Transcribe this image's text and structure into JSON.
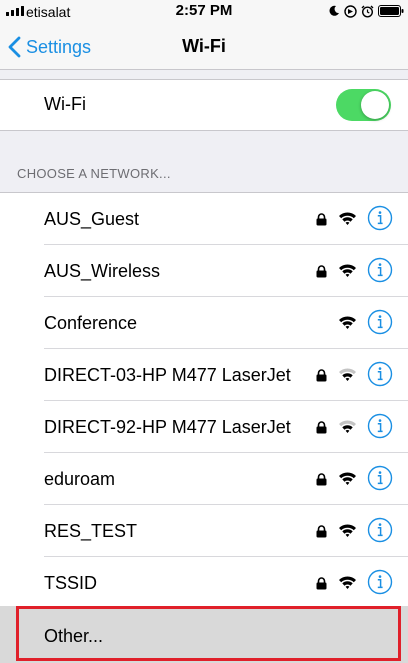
{
  "status_bar": {
    "carrier": "etisalat",
    "time": "2:57 PM",
    "icons": [
      "signal-bars-icon",
      "moon-icon",
      "location-lock-icon",
      "alarm-icon",
      "battery-icon"
    ]
  },
  "nav": {
    "back_label": "Settings",
    "title": "Wi-Fi"
  },
  "wifi_toggle": {
    "label": "Wi-Fi",
    "state": "on",
    "on_color": "#4cd964"
  },
  "section_header": "CHOOSE A NETWORK...",
  "networks": [
    {
      "name": "AUS_Guest",
      "secured": true,
      "signal": "full"
    },
    {
      "name": "AUS_Wireless",
      "secured": true,
      "signal": "full"
    },
    {
      "name": "Conference",
      "secured": false,
      "signal": "full"
    },
    {
      "name": "DIRECT-03-HP M477 LaserJet",
      "secured": true,
      "signal": "weak"
    },
    {
      "name": "DIRECT-92-HP M477 LaserJet",
      "secured": true,
      "signal": "weak"
    },
    {
      "name": "eduroam",
      "secured": true,
      "signal": "full"
    },
    {
      "name": "RES_TEST",
      "secured": true,
      "signal": "full"
    },
    {
      "name": "TSSID",
      "secured": true,
      "signal": "full"
    }
  ],
  "other": {
    "label": "Other...",
    "highlight_color": "#e0202a"
  },
  "colors": {
    "accent": "#1a8fe3",
    "background": "#efeff4"
  }
}
